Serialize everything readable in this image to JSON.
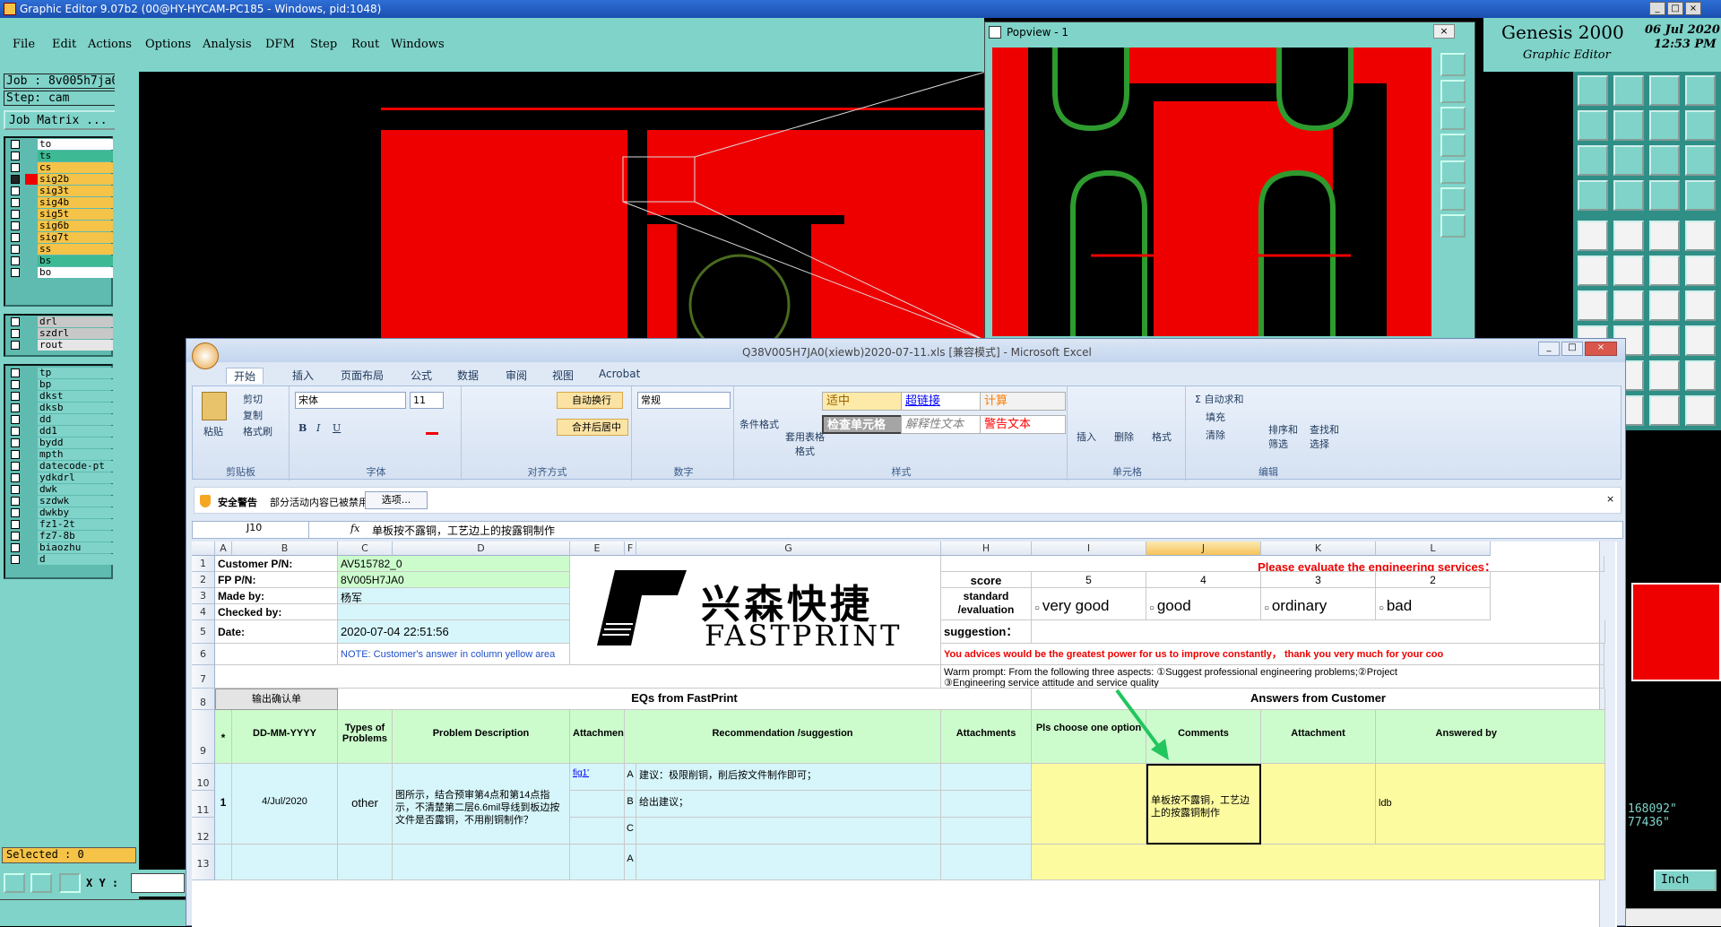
{
  "app_title": "Graphic Editor 9.07b2 (00@HY-HYCAM-PC185 - Windows, pid:1048)",
  "menu": [
    "File",
    "Edit",
    "Actions",
    "Options",
    "Analysis",
    "DFM",
    "Step",
    "Rout",
    "Windows"
  ],
  "job": {
    "job_label": "Job : 8v005h7ja0",
    "step_label": "Step: cam",
    "matrix_button": "Job Matrix ..."
  },
  "layers": [
    {
      "name": "to",
      "color": "#ffffff",
      "sel": false
    },
    {
      "name": "ts",
      "color": "#3dba93",
      "sel": false
    },
    {
      "name": "cs",
      "color": "#f5c347",
      "sel": false
    },
    {
      "name": "sig2b",
      "color": "#f5c347",
      "sel": true
    },
    {
      "name": "sig3t",
      "color": "#f5c347",
      "sel": false
    },
    {
      "name": "sig4b",
      "color": "#f5c347",
      "sel": false
    },
    {
      "name": "sig5t",
      "color": "#f5c347",
      "sel": false
    },
    {
      "name": "sig6b",
      "color": "#f5c347",
      "sel": false
    },
    {
      "name": "sig7t",
      "color": "#f5c347",
      "sel": false
    },
    {
      "name": "ss",
      "color": "#f5c347",
      "sel": false
    },
    {
      "name": "bs",
      "color": "#3dba93",
      "sel": false
    },
    {
      "name": "bo",
      "color": "#ffffff",
      "sel": false
    }
  ],
  "layers2": [
    "drl",
    "szdrl",
    "rout"
  ],
  "layers3": [
    "tp",
    "bp",
    "dkst",
    "dksb",
    "dd",
    "dd1",
    "bydd",
    "mpth",
    "datecode-pt",
    "ydkdrl",
    "dwk",
    "szdwk",
    "dwkby",
    "fz1-2t",
    "fz7-8b",
    "biaozhu",
    "d"
  ],
  "selected": "Selected : 0",
  "xy_label": "X Y :",
  "genesis": {
    "title": "Genesis 2000",
    "subtitle": "Graphic Editor",
    "date": "06 Jul 2020",
    "time": "12:53 PM"
  },
  "popview": {
    "title": "Popview - 1"
  },
  "coords": [
    "168092\"",
    "77436\""
  ],
  "units": "Inch",
  "excel": {
    "title": "Q38V005H7JA0(xiewb)2020-07-11.xls [兼容模式] - Microsoft Excel",
    "tabs": [
      "开始",
      "插入",
      "页面布局",
      "公式",
      "数据",
      "审阅",
      "视图",
      "Acrobat"
    ],
    "clipboard": {
      "paste": "粘贴",
      "cut": "剪切",
      "copy": "复制",
      "format": "格式刷",
      "label": "剪贴板"
    },
    "font": {
      "name": "宋体",
      "size": "11",
      "label": "字体"
    },
    "align": {
      "wrap": "自动换行",
      "merge": "合并后居中",
      "label": "对齐方式"
    },
    "number": {
      "format": "常规",
      "label": "数字"
    },
    "styles": {
      "cond": "条件格式",
      "table": "套用表格格式",
      "s1": "适中",
      "s2": "超链接",
      "s3": "计算",
      "s4": "检查单元格",
      "s5": "解释性文本",
      "s6": "警告文本",
      "label": "样式"
    },
    "cells": {
      "insert": "插入",
      "delete": "删除",
      "format": "格式",
      "label": "单元格"
    },
    "edit": {
      "sum": "Σ 自动求和",
      "fill": "填充",
      "clear": "清除",
      "sort": "排序和筛选",
      "find": "查找和选择",
      "label": "编辑"
    },
    "security": {
      "title": "安全警告",
      "msg": "部分活动内容已被禁用。",
      "btn": "选项..."
    },
    "namebox": "J10",
    "formula": "单板按不露铜，工艺边上的按露铜制作",
    "cols": [
      "A",
      "B",
      "C",
      "D",
      "E",
      "F",
      "G",
      "H",
      "I",
      "J",
      "K",
      "L"
    ],
    "rows": [
      "1",
      "2",
      "3",
      "4",
      "5",
      "6",
      "7",
      "8",
      "9",
      "10",
      "11",
      "12",
      "13"
    ],
    "customer_pn_label": "Customer P/N:",
    "customer_pn": "AV515782_0",
    "fp_pn_label": "FP P/N:",
    "fp_pn": "8V005H7JA0",
    "made_by_label": "Made by:",
    "made_by": "杨军",
    "checked_label": "Checked by:",
    "date_label": "Date:",
    "date": "2020-07-04 22:51:56",
    "note": "NOTE: Customer's  answer in column yellow area",
    "logo_cn": "兴森快捷",
    "logo_en": "FASTPRINT",
    "evaluate": "Please evaluate the engineering services：",
    "score_label": "score",
    "scores": [
      "5",
      "4",
      "3",
      "2"
    ],
    "standard_label": "standard /evaluation",
    "evals": [
      "very good",
      "good",
      "ordinary",
      "bad"
    ],
    "suggestion_label": "suggestion：",
    "advice": "You advices would be the greatest power for us to improve constantly，  thank you very much for your coo",
    "warm": "Warm prompt:  From the following three aspects: ①Suggest professional engineering problems;②Project",
    "warm2": "③Engineering service attitude and service quality",
    "output_confirm": "输出确认单",
    "eq_header": "EQs from FastPrint",
    "answers_header": "Answers from Customer",
    "h_star": "*",
    "h_date": "DD-MM-YYYY",
    "h_types": "Types of Problems",
    "h_desc": "Problem Description",
    "h_attach": "Attachment",
    "h_rec": "Recommendation /suggestion",
    "h_attachs": "Attachments",
    "h_option": "Pls choose one option",
    "h_comments": "Comments",
    "h_attach2": "Attachment",
    "h_answered": "Answered by",
    "r_num": "1",
    "r_date": "4/Jul/2020",
    "r_type": "other",
    "r_desc": "图所示，结合预审第4点和第14点指示，不清楚第二层6.6mil导线到板边按文件是否露铜，不用削铜制作？",
    "r_fig": "fig1'",
    "optA": "A",
    "optB": "B",
    "optC": "C",
    "recA": "建议：极限削铜，削后按文件制作即可；",
    "recB": "给出建议；",
    "comment": "单板按不露铜，工艺边上的按露铜制作",
    "answered": "ldb"
  }
}
